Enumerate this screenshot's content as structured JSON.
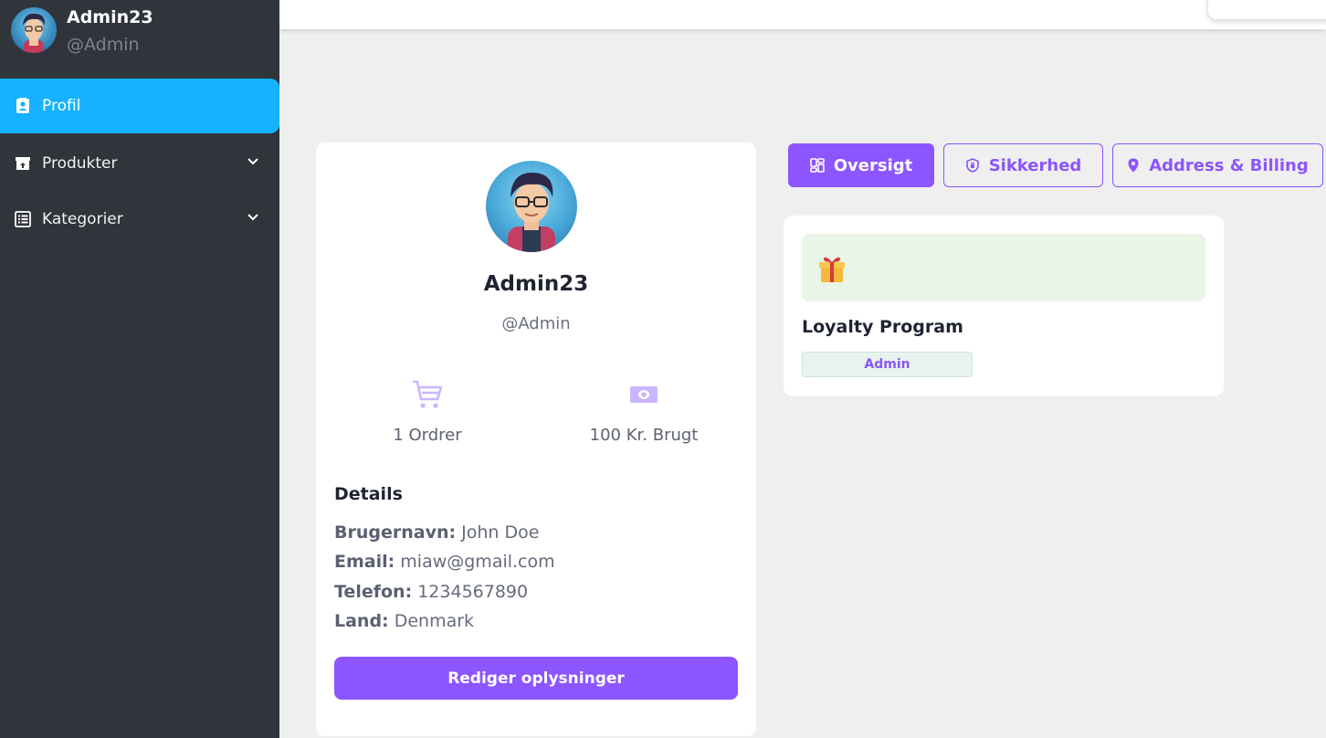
{
  "sidebar": {
    "user": {
      "name": "Admin23",
      "handle": "@Admin"
    },
    "items": [
      {
        "label": "Profil",
        "icon": "profile-icon",
        "active": true
      },
      {
        "label": "Produkter",
        "icon": "archive-box-icon",
        "expandable": true
      },
      {
        "label": "Kategorier",
        "icon": "list-table-icon",
        "expandable": true
      }
    ]
  },
  "profile": {
    "name": "Admin23",
    "handle": "@Admin",
    "stats": [
      {
        "label": "1 Ordrer",
        "icon": "cart-icon"
      },
      {
        "label": "100 Kr. Brugt",
        "icon": "money-icon"
      }
    ],
    "details_title": "Details",
    "details": [
      {
        "key": "Brugernavn:",
        "value": "John Doe"
      },
      {
        "key": "Email:",
        "value": "miaw@gmail.com"
      },
      {
        "key": "Telefon:",
        "value": "1234567890"
      },
      {
        "key": "Land:",
        "value": "Denmark"
      }
    ],
    "edit_button": "Rediger oplysninger"
  },
  "tabs": [
    {
      "label": "Oversigt",
      "icon": "dashboard-icon",
      "active": true
    },
    {
      "label": "Sikkerhed",
      "icon": "shield-icon",
      "active": false
    },
    {
      "label": "Address & Billing",
      "icon": "location-pin-icon",
      "active": false
    }
  ],
  "loyalty": {
    "icon": "gift-icon",
    "title": "Loyalty Program",
    "badge": "Admin"
  },
  "colors": {
    "sidebar_bg": "#30343b",
    "active_nav": "#16b1ff",
    "accent": "#8c55ff",
    "page_bg": "#efefef"
  }
}
